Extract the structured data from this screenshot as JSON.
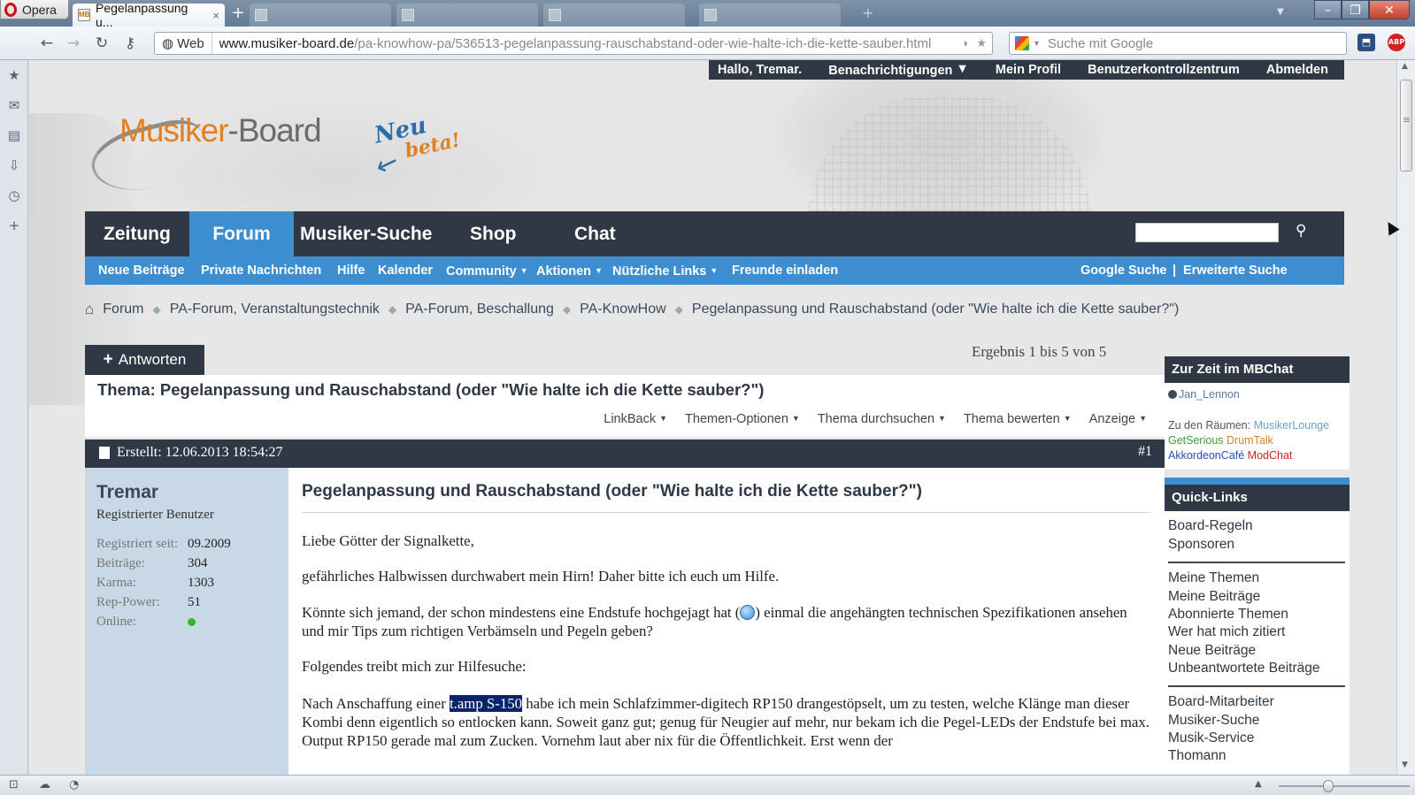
{
  "browser": {
    "app_name": "Opera",
    "active_tab_title": "Pegelanpassung u...",
    "tab_close": "×",
    "new_tab": "+",
    "web_label": "Web",
    "url_host": "www.musiker-board.de",
    "url_path": "/pa-knowhow-pa/536513-pegelanpassung-rauschabstand-oder-wie-halte-ich-die-kette-sauber.html",
    "search_placeholder": "Suche mit Google"
  },
  "userbar": {
    "greeting": "Hallo, Tremar.",
    "notifications": "Benachrichtigungen",
    "profile": "Mein Profil",
    "control_center": "Benutzerkontrollzentrum",
    "logout": "Abmelden"
  },
  "logo": {
    "part1": "Musiker",
    "part2": "-Board",
    "badge_line1": "Neu",
    "badge_line2": "beta!"
  },
  "main_nav": [
    "Zeitung",
    "Forum",
    "Musiker-Suche",
    "Shop",
    "Chat"
  ],
  "sub_nav": {
    "new_posts": "Neue Beiträge",
    "private_messages": "Private Nachrichten",
    "help": "Hilfe",
    "calendar": "Kalender",
    "community": "Community",
    "actions": "Aktionen",
    "useful_links": "Nützliche Links",
    "invite": "Freunde einladen",
    "google_search": "Google Suche",
    "pipe": "|",
    "advanced_search": "Erweiterte Suche"
  },
  "breadcrumb": [
    "Forum",
    "PA-Forum, Veranstaltungstechnik",
    "PA-Forum, Beschallung",
    "PA-KnowHow",
    "Pegelanpassung und Rauschabstand (oder \"Wie halte ich die Kette sauber?\")"
  ],
  "thread": {
    "reply_label": "Antworten",
    "result_count": "Ergebnis 1 bis 5 von 5",
    "title": "Thema: Pegelanpassung und Rauschabstand (oder \"Wie halte ich die Kette sauber?\")",
    "tools": [
      "LinkBack",
      "Themen-Optionen",
      "Thema durchsuchen",
      "Thema bewerten",
      "Anzeige"
    ]
  },
  "post": {
    "created": "Erstellt: 12.06.2013 18:54:27",
    "number": "#1",
    "author": "Tremar",
    "role": "Registrierter Benutzer",
    "stats": {
      "since_label": "Registriert seit:",
      "since": "09.2009",
      "posts_label": "Beiträge:",
      "posts": "304",
      "karma_label": "Karma:",
      "karma": "1303",
      "rep_label": "Rep-Power:",
      "rep": "51",
      "online_label": "Online:"
    },
    "title": "Pegelanpassung und Rauschabstand (oder \"Wie halte ich die Kette sauber?\")",
    "p1": "Liebe Götter der Signalkette,",
    "p2": "gefährliches Halbwissen durchwabert mein Hirn! Daher bitte ich euch um Hilfe.",
    "p3a": "Könnte sich jemand, der schon mindestens eine Endstufe hochgejagt hat (",
    "p3b": ") einmal die angehängten technischen Spezifikationen ansehen und mir Tips zum richtigen Verbämseln und Pegeln geben?",
    "p4": "Folgendes treibt mich zur Hilfesuche:",
    "p5a": "Nach Anschaffung einer ",
    "p5_highlight": "t.amp S-150",
    "p5b": " habe ich mein Schlafzimmer-digitech RP150 drangestöpselt, um zu testen, welche Klänge man dieser Kombi denn eigentlich so entlocken kann. Soweit ganz gut; genug für Neugier auf mehr, nur bekam ich die Pegel-LEDs der Endstufe bei max. Output RP150 gerade mal zum Zucken. Vornehm laut aber nix für die Öffentlichkeit. Erst wenn der"
  },
  "sidebar": {
    "chat_title": "Zur Zeit im MBChat",
    "chat_user": "Jan_Lennon",
    "rooms_label": "Zu den Räumen:",
    "rooms": [
      "MusikerLounge",
      "GetSerious",
      "DrumTalk",
      "AkkordeonCafé",
      "ModChat"
    ],
    "quicklinks_title": "Quick-Links",
    "quicklinks": [
      "Board-Regeln",
      "Sponsoren",
      "Meine Themen",
      "Meine Beiträge",
      "Abonnierte Themen",
      "Wer hat mich zitiert",
      "Neue Beiträge",
      "Unbeantwortete Beiträge",
      "Board-Mitarbeiter",
      "Musiker-Suche",
      "Musik-Service",
      "Thomann"
    ]
  },
  "colors": {
    "dark_nav": "#2f3844",
    "blue_nav": "#3d8ed1",
    "postbit_bg": "#c9d8e6",
    "logo_orange": "#e28024"
  }
}
